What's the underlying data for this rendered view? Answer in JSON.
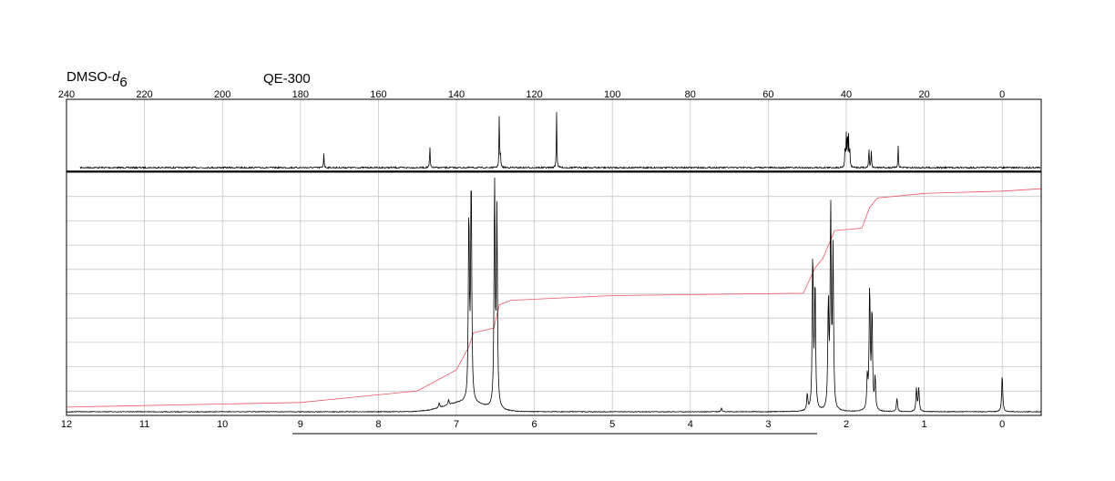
{
  "header": {
    "solvent_main": "DMSO-",
    "solvent_italic": "d",
    "solvent_sub": "6",
    "instrument": "QE-300"
  },
  "colors": {
    "spectrum": "#000000",
    "integral": "#ee5566",
    "grid": "#c8c8c8",
    "frame": "#000000"
  },
  "chart_data": [
    {
      "type": "line",
      "name": "13C spectrum (top panel)",
      "xlim": [
        240,
        -10
      ],
      "ticks": [
        240,
        220,
        200,
        180,
        160,
        140,
        120,
        100,
        80,
        60,
        40,
        20,
        0
      ],
      "peaks": [
        {
          "x": 174.0,
          "h": 0.22
        },
        {
          "x": 146.8,
          "h": 0.33
        },
        {
          "x": 129.0,
          "h": 0.8
        },
        {
          "x": 128.7,
          "h": 0.2
        },
        {
          "x": 114.3,
          "h": 0.84
        },
        {
          "x": 40.3,
          "h": 0.36
        },
        {
          "x": 40.0,
          "h": 0.48
        },
        {
          "x": 39.7,
          "h": 0.55
        },
        {
          "x": 39.4,
          "h": 0.46
        },
        {
          "x": 39.1,
          "h": 0.3
        },
        {
          "x": 34.2,
          "h": 0.32
        },
        {
          "x": 33.6,
          "h": 0.28
        },
        {
          "x": 26.7,
          "h": 0.34
        }
      ]
    },
    {
      "type": "line",
      "name": "1H spectrum (bottom panel)",
      "xlim": [
        12,
        -0.5
      ],
      "ticks": [
        12,
        11,
        10,
        9,
        8,
        7,
        6,
        5,
        4,
        3,
        2,
        1,
        0
      ],
      "peaks": [
        {
          "x": 6.84,
          "h": 0.8
        },
        {
          "x": 6.81,
          "h": 0.97
        },
        {
          "x": 6.51,
          "h": 1.0
        },
        {
          "x": 6.48,
          "h": 0.83
        },
        {
          "x": 7.22,
          "h": 0.02
        },
        {
          "x": 7.1,
          "h": 0.02
        },
        {
          "x": 3.6,
          "h": 0.015
        },
        {
          "x": 2.5,
          "h": 0.07
        },
        {
          "x": 2.43,
          "h": 0.67
        },
        {
          "x": 2.4,
          "h": 0.55
        },
        {
          "x": 2.23,
          "h": 0.45
        },
        {
          "x": 2.2,
          "h": 0.86
        },
        {
          "x": 2.17,
          "h": 0.68
        },
        {
          "x": 1.73,
          "h": 0.14
        },
        {
          "x": 1.7,
          "h": 0.53
        },
        {
          "x": 1.67,
          "h": 0.43
        },
        {
          "x": 1.63,
          "h": 0.14
        },
        {
          "x": 1.35,
          "h": 0.06
        },
        {
          "x": 1.1,
          "h": 0.1
        },
        {
          "x": 1.07,
          "h": 0.1
        },
        {
          "x": 0.0,
          "h": 0.16
        }
      ],
      "integral": [
        {
          "x": 12.0,
          "y": 0.02
        },
        {
          "x": 9.0,
          "y": 0.04
        },
        {
          "x": 7.5,
          "y": 0.09
        },
        {
          "x": 7.0,
          "y": 0.18
        },
        {
          "x": 6.84,
          "y": 0.28
        },
        {
          "x": 6.78,
          "y": 0.34
        },
        {
          "x": 6.52,
          "y": 0.36
        },
        {
          "x": 6.45,
          "y": 0.46
        },
        {
          "x": 6.3,
          "y": 0.48
        },
        {
          "x": 5.0,
          "y": 0.5
        },
        {
          "x": 2.55,
          "y": 0.51
        },
        {
          "x": 2.4,
          "y": 0.62
        },
        {
          "x": 2.3,
          "y": 0.66
        },
        {
          "x": 2.15,
          "y": 0.78
        },
        {
          "x": 1.8,
          "y": 0.79
        },
        {
          "x": 1.7,
          "y": 0.88
        },
        {
          "x": 1.6,
          "y": 0.92
        },
        {
          "x": 1.0,
          "y": 0.94
        },
        {
          "x": 0.0,
          "y": 0.95
        },
        {
          "x": -0.5,
          "y": 0.96
        }
      ]
    }
  ]
}
